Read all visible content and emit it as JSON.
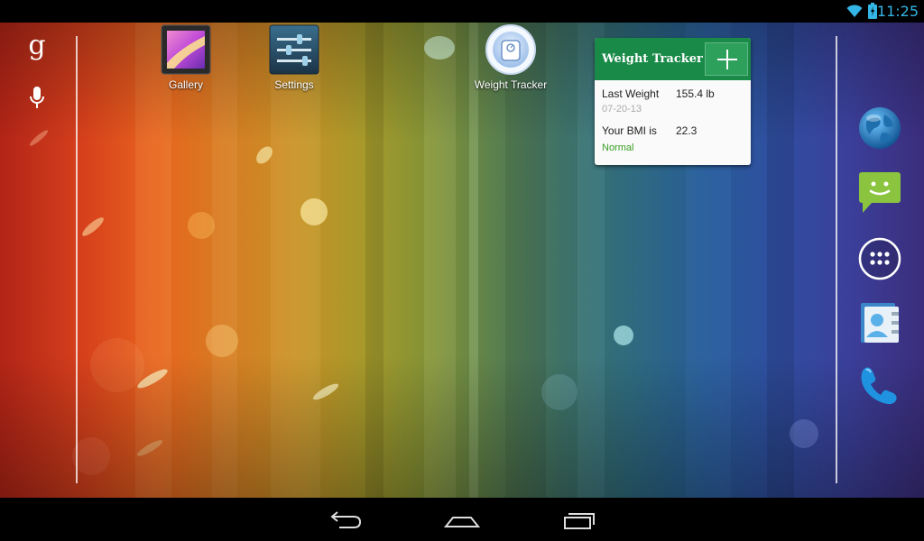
{
  "status_bar": {
    "time": "11:25",
    "icons": [
      "wifi-icon",
      "battery-icon"
    ],
    "accent_color": "#33b5e5"
  },
  "search_bar": {
    "google_logo": "g",
    "icons": [
      "google-search-icon",
      "mic-icon"
    ]
  },
  "shortcuts": [
    {
      "label": "Gallery",
      "icon": "gallery-icon"
    },
    {
      "label": "Settings",
      "icon": "settings-icon"
    },
    {
      "label": "Weight Tracker",
      "icon": "weight-tracker-icon"
    }
  ],
  "widget": {
    "title": "Weight Tracker",
    "add_icon": "plus-icon",
    "last_weight_label": "Last Weight",
    "last_weight_value": "155.4 lb",
    "last_weight_date": "07-20-13",
    "bmi_label": "Your BMI is",
    "bmi_value": "22.3",
    "bmi_status": "Normal",
    "header_color": "#1a8a48",
    "status_color": "#3a9d23"
  },
  "dock": [
    {
      "icon": "browser-icon"
    },
    {
      "icon": "messaging-icon"
    },
    {
      "icon": "all-apps-icon"
    },
    {
      "icon": "contacts-icon"
    },
    {
      "icon": "phone-icon"
    }
  ],
  "nav_bar": {
    "buttons": [
      "back-icon",
      "home-icon",
      "recent-apps-icon"
    ]
  }
}
